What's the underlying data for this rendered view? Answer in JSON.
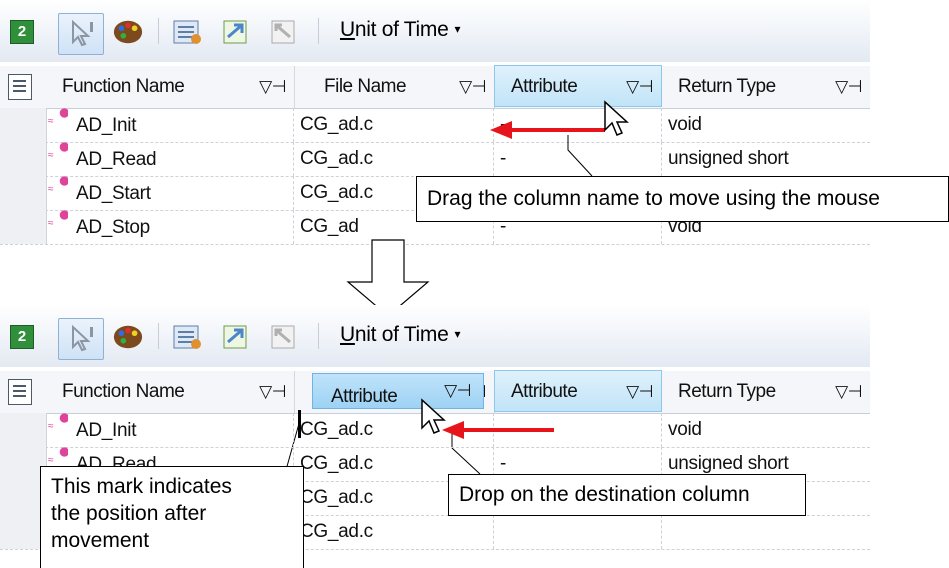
{
  "toolbar": {
    "icons": [
      "refresh-icon",
      "pointer-icon",
      "palette-icon",
      "filter-settings-icon",
      "expand-icon",
      "collapse-icon"
    ],
    "unit_of_time_first": "U",
    "unit_of_time_rest": "nit of Time",
    "dropdown_arrow": "▾"
  },
  "columns": {
    "function_name": "Function Name",
    "file_name": "File Name",
    "attribute": "Attribute",
    "return_type": "Return Type",
    "filter_glyph": "▽⊣"
  },
  "top_rows": [
    {
      "function": "AD_Init",
      "file": "CG_ad.c",
      "attribute": "-",
      "return_type": "void"
    },
    {
      "function": "AD_Read",
      "file": "CG_ad.c",
      "attribute": "-",
      "return_type": "unsigned short"
    },
    {
      "function": "AD_Start",
      "file": "CG_ad.c",
      "attribute": "",
      "return_type": ""
    },
    {
      "function": "AD_Stop",
      "file": "CG_ad",
      "attribute": "-",
      "return_type": "void"
    }
  ],
  "bottom_rows": [
    {
      "function": "AD_Init",
      "file": "CG_ad.c",
      "attribute": "-",
      "return_type": "void"
    },
    {
      "function": "AD_Read",
      "file": "CG_ad.c",
      "attribute": "-",
      "return_type": "unsigned short"
    },
    {
      "function": "",
      "file": "CG_ad.c",
      "attribute": "",
      "return_type": ""
    },
    {
      "function": "",
      "file": "CG_ad.c",
      "attribute": "",
      "return_type": ""
    }
  ],
  "drag_ghost": {
    "label": "Attribute"
  },
  "annotations": {
    "drag_instruction": "Drag the column name to move using the mouse",
    "drop_instruction": "Drop on the destination column",
    "mark_line1": "This mark indicates",
    "mark_line2": "the position after",
    "mark_line3": "movement"
  },
  "colors": {
    "arrow_red": "#e8141c",
    "header_highlight": "#c1e4f8",
    "function_icon": "#e0449a"
  }
}
